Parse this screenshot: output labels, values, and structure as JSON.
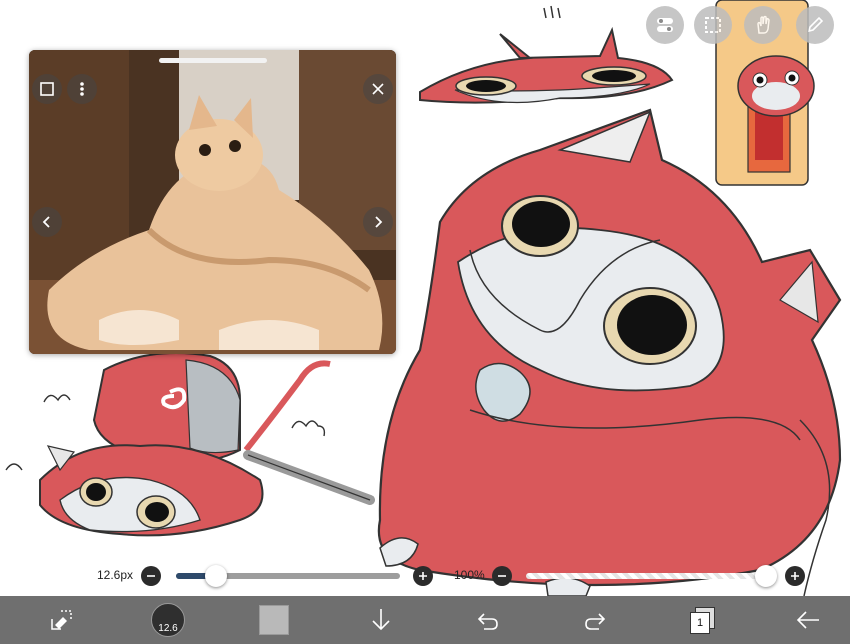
{
  "brush_size": {
    "label": "12.6px",
    "value_fraction": 0.18
  },
  "opacity": {
    "label": "100%",
    "value_fraction": 1.0
  },
  "toolbar": {
    "brush_preview_label": "12.6",
    "layer_count": "1",
    "current_color": "#b9b9b9"
  },
  "reference_window": {
    "visible": true
  },
  "top_tools": [
    "layer-toggle-icon",
    "selection-icon",
    "hand-icon",
    "pen-icon"
  ],
  "colors": {
    "toolbar_bg": "#6f6f6f",
    "character_red": "#d9585b",
    "character_white": "#e9ecef"
  }
}
